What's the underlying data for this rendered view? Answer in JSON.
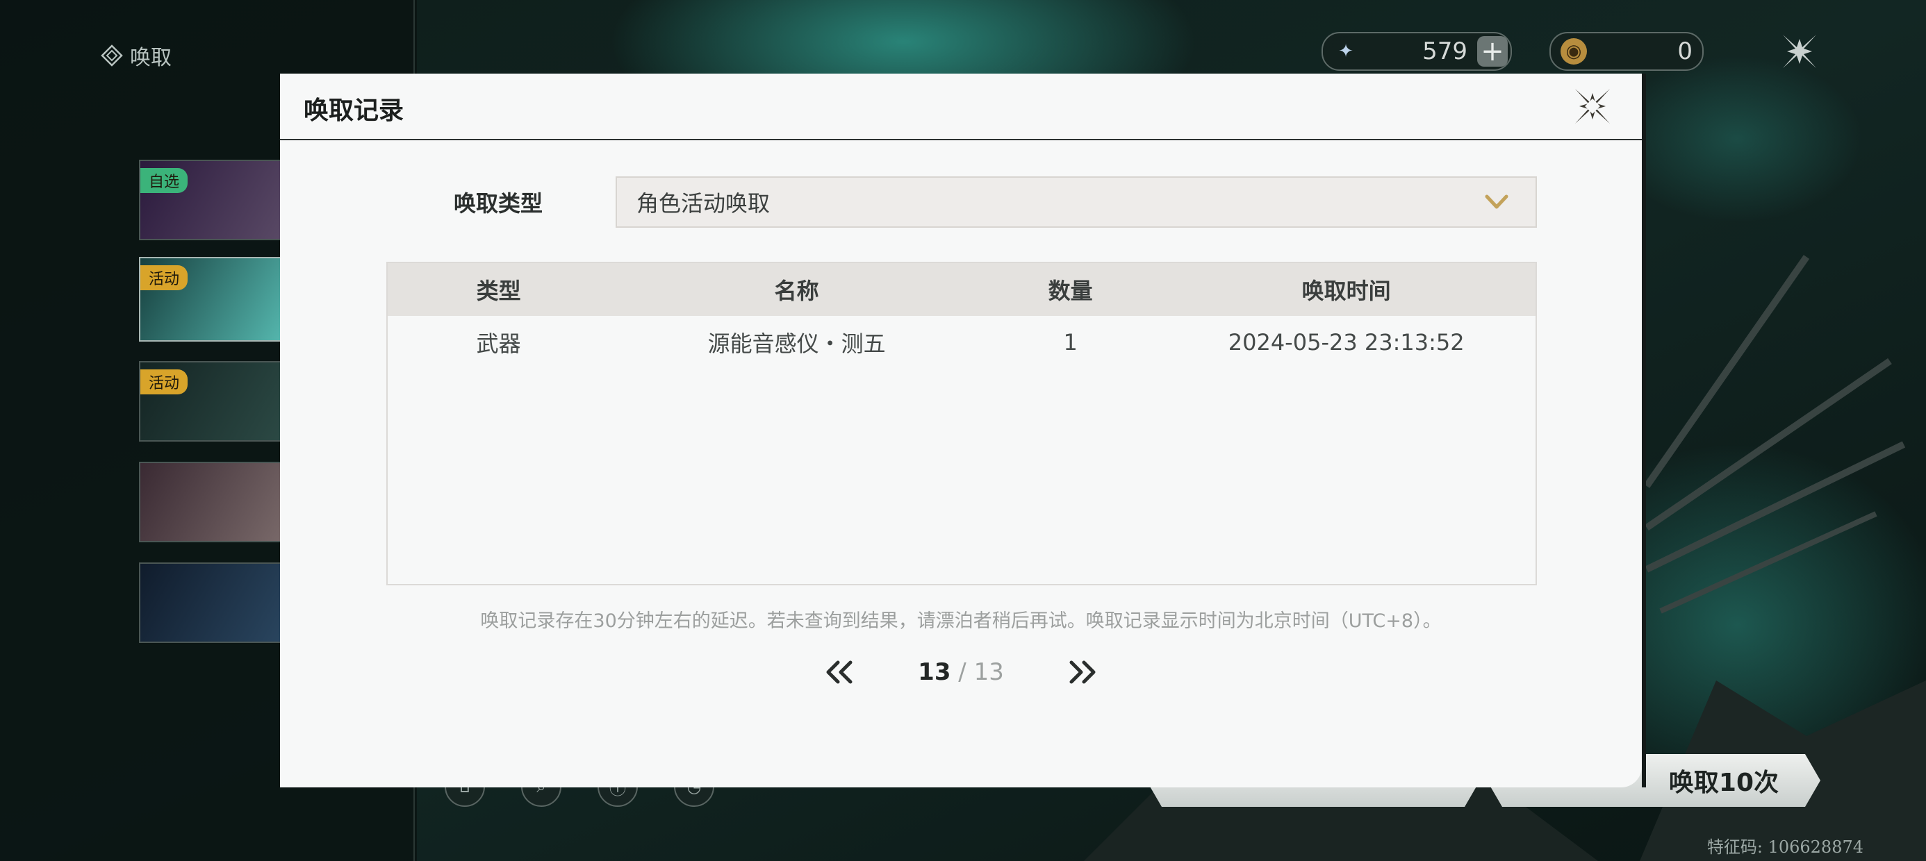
{
  "sidebar": {
    "title": "唤取",
    "banners": [
      {
        "tag": "自选",
        "tag_color": "#3bb37a"
      },
      {
        "tag": "活动",
        "tag_color": "#d8a42a"
      },
      {
        "tag": "活动",
        "tag_color": "#d8a42a"
      },
      {
        "tag": ""
      },
      {
        "tag": ""
      }
    ]
  },
  "currency": {
    "astrite": {
      "value": "579",
      "icon": "astrite-star-icon"
    },
    "tide": {
      "value": "0",
      "icon": "coin-icon"
    }
  },
  "bottom": {
    "pull_ten_label": "唤取10次",
    "feature_code": "特征码: 106628874"
  },
  "modal": {
    "title": "唤取记录",
    "type_label": "唤取类型",
    "type_value": "角色活动唤取",
    "columns": [
      "类型",
      "名称",
      "数量",
      "唤取时间"
    ],
    "rows": [
      {
        "type": "武器",
        "name": "源能音感仪・测五",
        "count": "1",
        "time": "2024-05-23 23:13:52"
      }
    ],
    "notice": "唤取记录存在30分钟左右的延迟。若未查询到结果，请漂泊者稍后再试。唤取记录显示时间为北京时间（UTC+8）。",
    "pagination": {
      "current": "13",
      "separator": "/",
      "total": "13"
    }
  },
  "colors": {
    "accent_gold": "#c3a25a",
    "modal_bg": "#f7f8f8",
    "table_header": "#e4e2df"
  }
}
